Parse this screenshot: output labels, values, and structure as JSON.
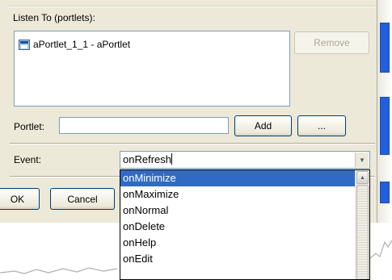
{
  "listen_group": {
    "label": "Listen To (portlets):",
    "items": [
      {
        "label": "aPortlet_1_1 - aPortlet",
        "icon": "portlet-icon"
      }
    ],
    "remove_label": "Remove"
  },
  "portlet_row": {
    "label": "Portlet:",
    "value": "",
    "add_label": "Add",
    "browse_label": "..."
  },
  "event_row": {
    "label": "Event:",
    "value": "onRefresh",
    "options": [
      "onMinimize",
      "onMaximize",
      "onNormal",
      "onDelete",
      "onHelp",
      "onEdit"
    ],
    "highlighted": "onMinimize"
  },
  "footer": {
    "ok_label": "OK",
    "cancel_label": "Cancel"
  },
  "colors": {
    "dialog_bg": "#ece9d8",
    "selection": "#316ac5",
    "xp_blue": "#245edb"
  }
}
